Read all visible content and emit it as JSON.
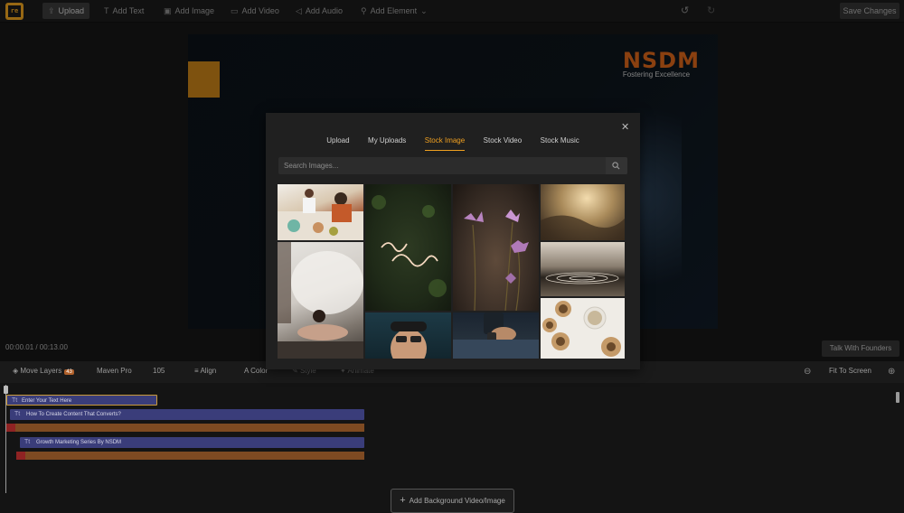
{
  "topbar": {
    "logo_text": "re",
    "upload": "Upload",
    "add_text": "Add Text",
    "add_image": "Add Image",
    "add_video": "Add Video",
    "add_audio": "Add Audio",
    "add_element": "Add Element",
    "save_changes": "Save Changes"
  },
  "stage": {
    "brand_title": "NSDM",
    "brand_subtitle": "Fostering Excellence",
    "timecode": "00:00.01 / 00:13.00",
    "talk_with_founders": "Talk With Founders"
  },
  "modal": {
    "tabs": [
      "Upload",
      "My Uploads",
      "Stock Image",
      "Stock Video",
      "Stock Music"
    ],
    "active_tab": "Stock Image",
    "search_placeholder": "Search Images..."
  },
  "editor_toolbar": {
    "move_layers": "Move Layers",
    "layer_count": "43",
    "font_name": "Maven Pro",
    "font_size": "105",
    "align": "Align",
    "color": "Color",
    "style": "Style",
    "animate": "Animate",
    "fit_to_screen": "Fit To Screen"
  },
  "timeline": {
    "tracks": [
      "Enter Your Text Here",
      "How To Create Content That Converts?",
      "Growth Marketing Series By NSDM"
    ],
    "text_icon": "Tt",
    "add_background": "Add Background Video/Image"
  },
  "colors": {
    "accent": "#f0a020",
    "brand": "#d4631a",
    "track_text": "#3a3d7a",
    "track_bar": "#7e4a22",
    "track_red": "#8f2323"
  }
}
